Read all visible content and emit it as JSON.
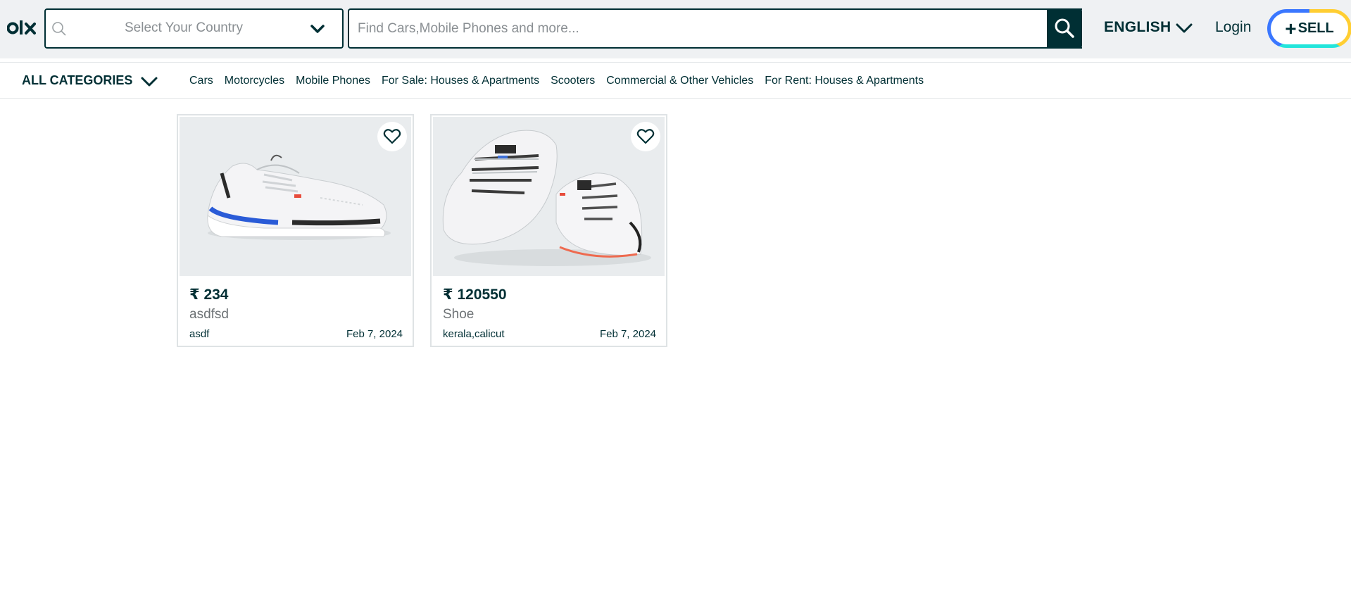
{
  "header": {
    "logo": "olx",
    "country_placeholder": "Select Your Country",
    "search_placeholder": "Find Cars,Mobile Phones and more...",
    "language": "ENGLISH",
    "login": "Login",
    "sell_plus": "+",
    "sell_label": "SELL",
    "icons": [
      "search-icon",
      "chevron-down-icon"
    ]
  },
  "categories": {
    "all_label": "ALL CATEGORIES",
    "links": [
      "Cars",
      "Motorcycles",
      "Mobile Phones",
      "For Sale: Houses & Apartments",
      "Scooters",
      "Commercial & Other Vehicles",
      "For Rent: Houses & Apartments"
    ]
  },
  "listings": [
    {
      "price": "₹ 234",
      "title": "asdfsd",
      "location": "asdf",
      "date": "Feb 7, 2024",
      "image": "white sneaker with blue sole stripe"
    },
    {
      "price": "₹ 120550",
      "title": "Shoe",
      "location": "kerala,calicut",
      "date": "Feb 7, 2024",
      "image": "pair of white sneakers"
    }
  ],
  "colors": {
    "brand": "#002f34",
    "header_bg": "#eff1f3",
    "sell_ring": [
      "#ffce32",
      "#23e5db",
      "#3a77ff"
    ]
  }
}
